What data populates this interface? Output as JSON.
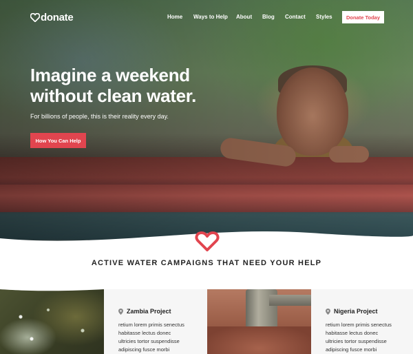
{
  "brand": {
    "logo_text": "donate",
    "accent": "#e1454f"
  },
  "nav": {
    "items": [
      "Home",
      "Ways to Help",
      "About",
      "Blog",
      "Contact",
      "Styles"
    ],
    "cta_label": "Donate Today"
  },
  "hero": {
    "title_line1": "Imagine a weekend",
    "title_line2": "without clean water.",
    "subtitle": "For billions of people, this is their reality every day.",
    "button_label": "How You Can Help"
  },
  "section": {
    "title": "ACTIVE WATER CAMPAIGNS THAT NEED YOUR HELP"
  },
  "projects": [
    {
      "title": "Zambia Project",
      "lines": [
        "retium lorem primis senectus",
        "habitasse lectus donec",
        "ultricies tortor suspendisse",
        "adipiscing fusce morbi"
      ]
    },
    {
      "title": "Nigeria Project",
      "lines": [
        "retium lorem primis senectus",
        "habitasse lectus donec",
        "ultricies tortor suspendisse",
        "adipiscing fusce morbi"
      ]
    }
  ],
  "icons": {
    "logo": "heart-icon",
    "location": "map-pin-icon",
    "divider": "heart-outline-icon"
  }
}
